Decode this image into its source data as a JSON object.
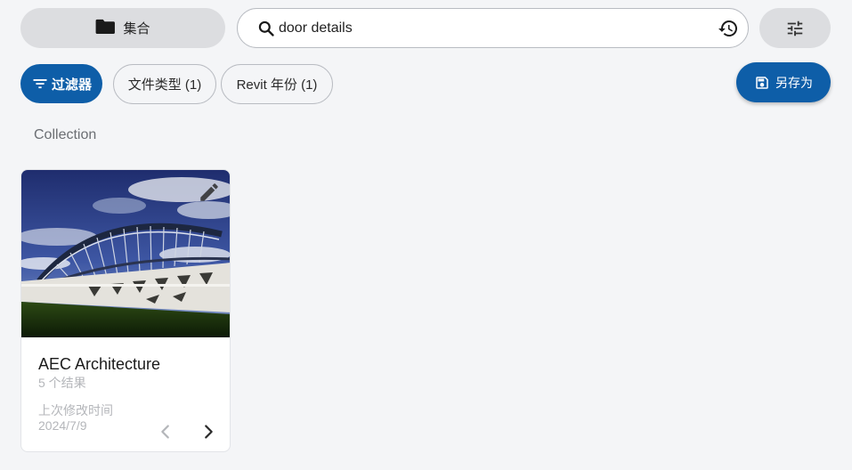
{
  "header": {
    "collections_label": "集合",
    "search_value": "door details",
    "search_placeholder": "",
    "icons": {
      "collections": "folder-icon",
      "search": "search-icon",
      "history": "history-icon",
      "settings": "tune-icon"
    }
  },
  "filters": {
    "filter_label": "过滤器",
    "chips": [
      {
        "label": "文件类型 (1)"
      },
      {
        "label": "Revit 年份 (1)"
      }
    ],
    "save_as_label": "另存为"
  },
  "section": {
    "label": "Collection"
  },
  "cards": [
    {
      "title": "AEC Architecture",
      "count": "5 个结果",
      "modified_label": "上次修改时间",
      "modified_date": "2024/7/9",
      "icons": {
        "edit": "edit-icon",
        "prev": "chevron-left-icon",
        "next": "chevron-right-icon"
      }
    }
  ],
  "colors": {
    "accent": "#0e5ea8",
    "background": "#f4f5f7",
    "button_gray": "#dcdde0",
    "muted_text": "#b4b6ba"
  }
}
